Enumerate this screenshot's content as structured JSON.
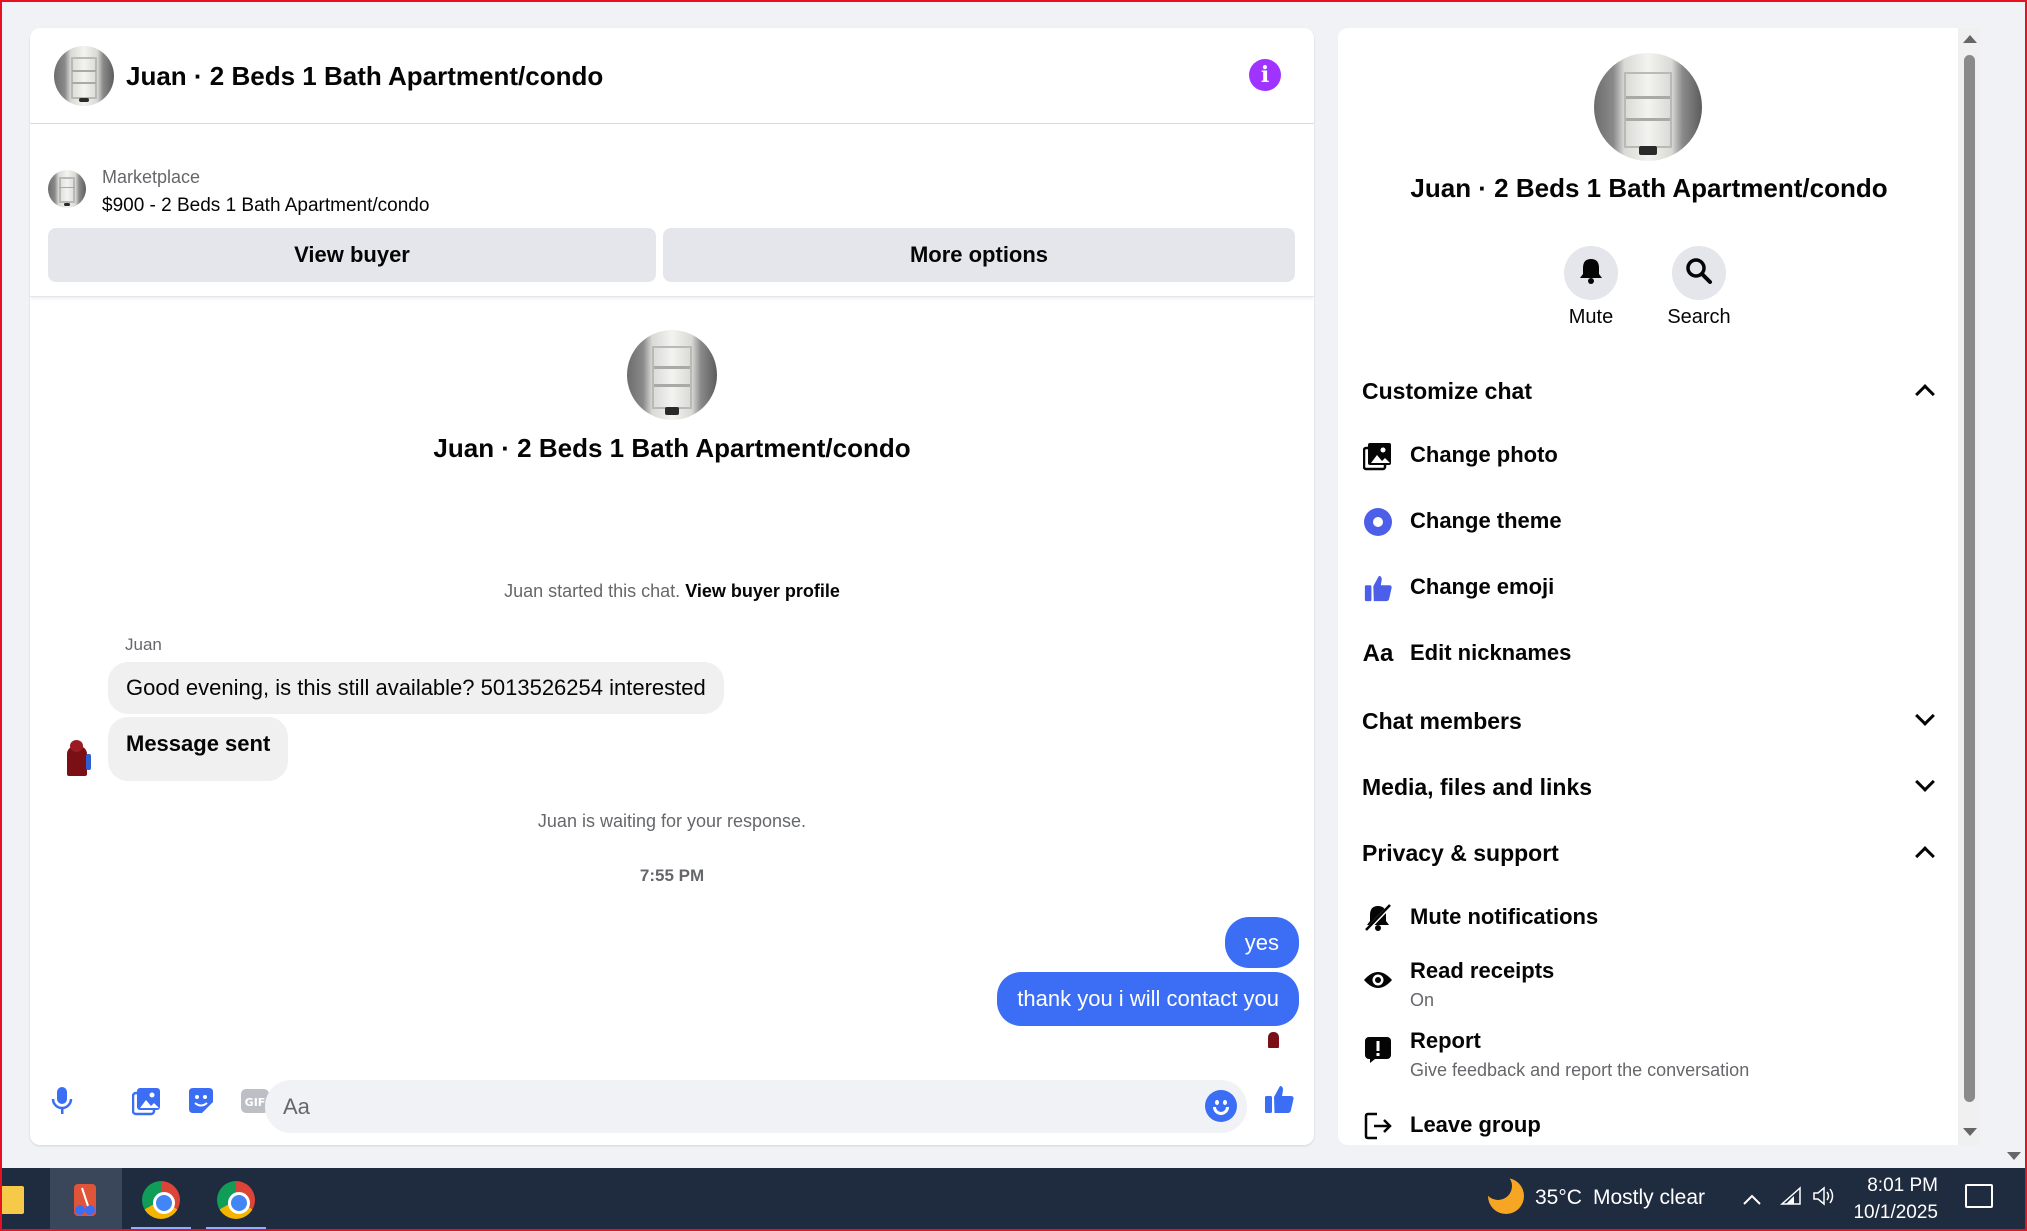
{
  "chat": {
    "header_title": "Juan · 2 Beds 1 Bath Apartment/condo",
    "marketplace_label": "Marketplace",
    "listing_title": "$900 - 2 Beds 1 Bath Apartment/condo",
    "view_buyer_label": "View buyer",
    "more_options_label": "More options",
    "intro_name": "Juan · 2 Beds 1 Bath Apartment/condo",
    "started_text": "Juan started this chat.",
    "view_buyer_profile_link": "View buyer profile",
    "sender_name": "Juan",
    "messages_in": [
      "Good evening, is this still available? 5013526254 interested",
      "Message sent"
    ],
    "waiting_text": "Juan is waiting for your response.",
    "timestamp": "7:55 PM",
    "messages_out": [
      "yes",
      "thank you i will contact you"
    ],
    "input_placeholder": "Aa",
    "accent_color": "#3b6ef5"
  },
  "info_panel": {
    "name": "Juan · 2 Beds 1 Bath Apartment/condo",
    "mute_label": "Mute",
    "search_label": "Search",
    "customize_header": "Customize chat",
    "customize_items": [
      "Change photo",
      "Change theme",
      "Change emoji",
      "Edit nicknames"
    ],
    "chat_members": "Chat members",
    "media_files": "Media, files and links",
    "privacy_header": "Privacy & support",
    "mute_notifications": "Mute notifications",
    "read_receipts": "Read receipts",
    "read_receipts_value": "On",
    "report": "Report",
    "report_sub": "Give feedback and report the conversation",
    "leave_group": "Leave group"
  },
  "taskbar": {
    "temperature": "35°C",
    "weather": "Mostly clear",
    "time": "8:01 PM",
    "date": "10/1/2025"
  }
}
